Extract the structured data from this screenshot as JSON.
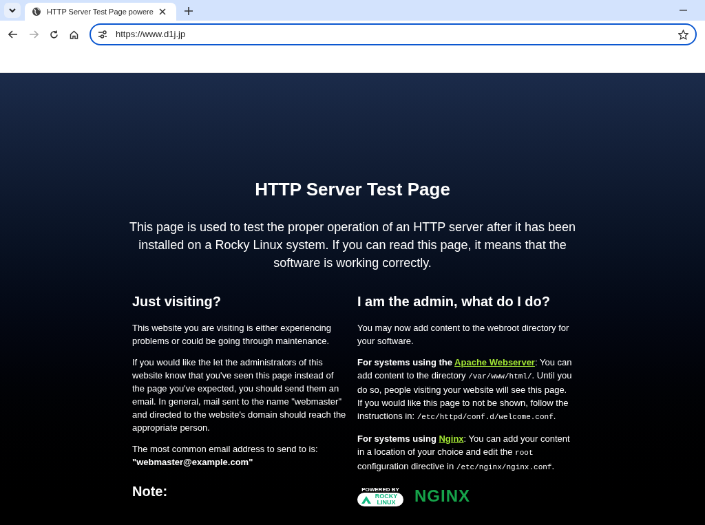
{
  "browser": {
    "tab": {
      "title": "HTTP Server Test Page powere",
      "selected": true
    },
    "address": "https://www.d1j.jp"
  },
  "page": {
    "title": "HTTP Server Test Page",
    "intro": "This page is used to test the proper operation of an HTTP server after it has been installed on a Rocky Linux system. If you can read this page, it means that the software is working correctly.",
    "columns": [
      {
        "heading": "Just visiting?",
        "paragraphs": [
          [
            {
              "kind": "text",
              "text": "This website you are visiting is either experiencing problems or could be going through maintenance."
            }
          ],
          [
            {
              "kind": "text",
              "text": "If you would like the let the administrators of this website know that you've seen this page instead of the page you've expected, you should send them an email. In general, mail sent to the name \"webmaster\" and directed to the website's domain should reach the appropriate person."
            }
          ],
          [
            {
              "kind": "text",
              "text": "The most common email address to send to is: "
            },
            {
              "kind": "bold",
              "text": "\"webmaster@example.com\""
            }
          ]
        ],
        "subheading": "Note:"
      },
      {
        "heading": "I am the admin, what do I do?",
        "paragraphs": [
          [
            {
              "kind": "text",
              "text": "You may now add content to the webroot directory for your software."
            }
          ],
          [
            {
              "kind": "bold",
              "text": "For systems using the "
            },
            {
              "kind": "link",
              "text": "Apache Webserver"
            },
            {
              "kind": "text",
              "text": ": You can add content to the directory "
            },
            {
              "kind": "code",
              "text": "/var/www/html/"
            },
            {
              "kind": "text",
              "text": ". Until you do so, people visiting your website will see this page. If you would like this page to not be shown, follow the instructions in: "
            },
            {
              "kind": "code",
              "text": "/etc/httpd/conf.d/welcome.conf"
            },
            {
              "kind": "text",
              "text": "."
            }
          ],
          [
            {
              "kind": "bold",
              "text": "For systems using "
            },
            {
              "kind": "link",
              "text": "Nginx"
            },
            {
              "kind": "text",
              "text": ": You can add your content in a location of your choice and edit the "
            },
            {
              "kind": "code",
              "text": "root"
            },
            {
              "kind": "text",
              "text": " configuration directive in "
            },
            {
              "kind": "code",
              "text": "/etc/nginx/nginx.conf"
            },
            {
              "kind": "text",
              "text": "."
            }
          ]
        ],
        "logos": {
          "rocky_caption": "POWERED BY",
          "rocky_name": "ROCKY LINUX",
          "nginx": "NGINX"
        }
      }
    ]
  }
}
